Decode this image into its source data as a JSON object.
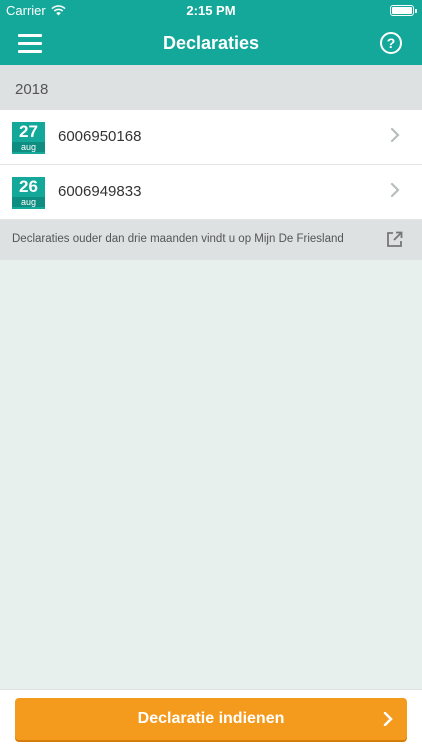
{
  "status_bar": {
    "carrier": "Carrier",
    "time": "2:15 PM"
  },
  "nav": {
    "title": "Declaraties",
    "help_glyph": "?"
  },
  "year_header": "2018",
  "declarations": [
    {
      "day": "27",
      "month": "aug",
      "number": "6006950168"
    },
    {
      "day": "26",
      "month": "aug",
      "number": "6006949833"
    }
  ],
  "info_bar": {
    "text": "Declaraties ouder dan drie maanden vindt u op Mijn De Friesland"
  },
  "submit_button": {
    "label": "Declaratie indienen"
  },
  "colors": {
    "primary": "#14a89a",
    "accent": "#f49a1c",
    "background": "#e8f0ee",
    "section": "#dde1e1"
  },
  "icons": {
    "menu": "hamburger-icon",
    "help": "question-circle-icon",
    "row_chevron": "chevron-right-icon",
    "external": "external-link-icon",
    "wifi": "wifi-icon",
    "battery": "battery-icon"
  }
}
